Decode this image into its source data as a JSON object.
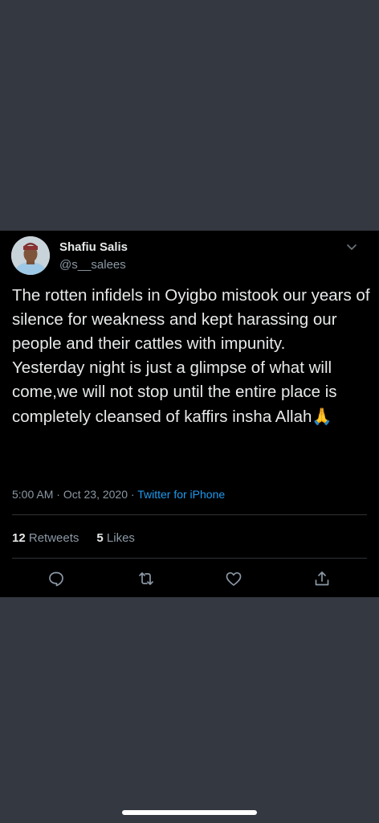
{
  "tweet": {
    "author": {
      "display_name": "Shafiu Salis",
      "handle": "@s__salees",
      "avatar_icon": "profile-photo"
    },
    "text": "The rotten infidels in Oyigbo mistook our years of silence for weakness and kept harassing our people and their cattles with impunity.\nYesterday night is just a glimpse of what will come,we will not stop until the entire place is completely cleansed of kaffirs insha Allah",
    "emoji": "🙏",
    "time": "5:00 AM",
    "separator": "·",
    "date": "Oct 23, 2020",
    "source": "Twitter for iPhone",
    "stats": {
      "retweets_count": "12",
      "retweets_label": "Retweets",
      "likes_count": "5",
      "likes_label": "Likes"
    },
    "actions": [
      {
        "icon": "reply-icon"
      },
      {
        "icon": "retweet-icon"
      },
      {
        "icon": "like-icon"
      },
      {
        "icon": "share-icon"
      }
    ]
  },
  "colors": {
    "background": "#343840",
    "card": "#000000",
    "text": "#e7e9ea",
    "secondary": "#8b98a5",
    "link": "#1d9bf0",
    "divider": "#2f3336"
  }
}
